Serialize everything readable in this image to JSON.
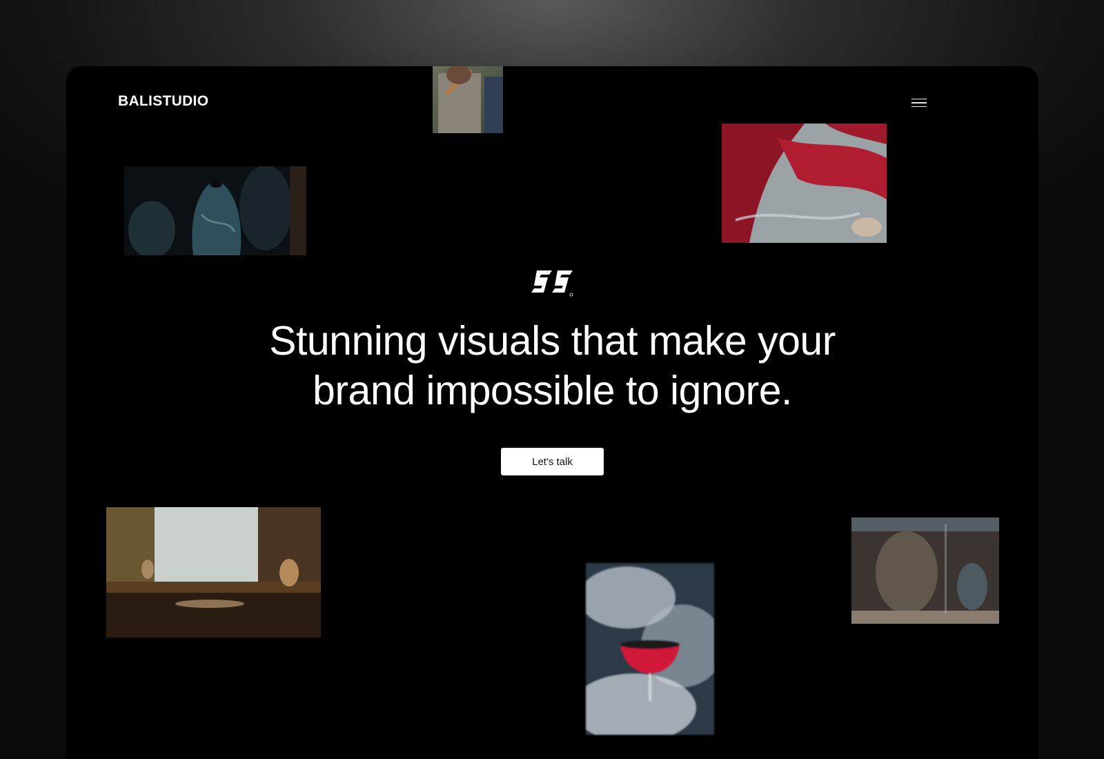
{
  "header": {
    "logo": "BALISTUDIO",
    "menu_icon": "hamburger-menu-icon"
  },
  "hero": {
    "mark_icon": "studio-monogram-icon",
    "headline_line1": "Stunning visuals that make your",
    "headline_line2": "brand impossible to ignore.",
    "cta_label": "Let's talk"
  },
  "colors": {
    "page_background": "#000000",
    "text": "#ffffff",
    "button_background": "#ffffff",
    "button_text": "#111111"
  }
}
